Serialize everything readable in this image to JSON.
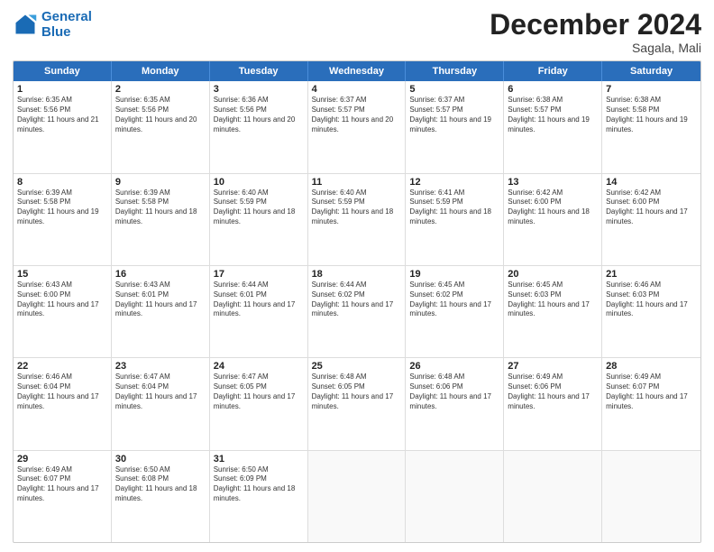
{
  "logo": {
    "line1": "General",
    "line2": "Blue"
  },
  "title": "December 2024",
  "location": "Sagala, Mali",
  "header_days": [
    "Sunday",
    "Monday",
    "Tuesday",
    "Wednesday",
    "Thursday",
    "Friday",
    "Saturday"
  ],
  "weeks": [
    [
      {
        "day": "1",
        "sunrise": "6:35 AM",
        "sunset": "5:56 PM",
        "daylight": "11 hours and 21 minutes."
      },
      {
        "day": "2",
        "sunrise": "6:35 AM",
        "sunset": "5:56 PM",
        "daylight": "11 hours and 20 minutes."
      },
      {
        "day": "3",
        "sunrise": "6:36 AM",
        "sunset": "5:56 PM",
        "daylight": "11 hours and 20 minutes."
      },
      {
        "day": "4",
        "sunrise": "6:37 AM",
        "sunset": "5:57 PM",
        "daylight": "11 hours and 20 minutes."
      },
      {
        "day": "5",
        "sunrise": "6:37 AM",
        "sunset": "5:57 PM",
        "daylight": "11 hours and 19 minutes."
      },
      {
        "day": "6",
        "sunrise": "6:38 AM",
        "sunset": "5:57 PM",
        "daylight": "11 hours and 19 minutes."
      },
      {
        "day": "7",
        "sunrise": "6:38 AM",
        "sunset": "5:58 PM",
        "daylight": "11 hours and 19 minutes."
      }
    ],
    [
      {
        "day": "8",
        "sunrise": "6:39 AM",
        "sunset": "5:58 PM",
        "daylight": "11 hours and 19 minutes."
      },
      {
        "day": "9",
        "sunrise": "6:39 AM",
        "sunset": "5:58 PM",
        "daylight": "11 hours and 18 minutes."
      },
      {
        "day": "10",
        "sunrise": "6:40 AM",
        "sunset": "5:59 PM",
        "daylight": "11 hours and 18 minutes."
      },
      {
        "day": "11",
        "sunrise": "6:40 AM",
        "sunset": "5:59 PM",
        "daylight": "11 hours and 18 minutes."
      },
      {
        "day": "12",
        "sunrise": "6:41 AM",
        "sunset": "5:59 PM",
        "daylight": "11 hours and 18 minutes."
      },
      {
        "day": "13",
        "sunrise": "6:42 AM",
        "sunset": "6:00 PM",
        "daylight": "11 hours and 18 minutes."
      },
      {
        "day": "14",
        "sunrise": "6:42 AM",
        "sunset": "6:00 PM",
        "daylight": "11 hours and 17 minutes."
      }
    ],
    [
      {
        "day": "15",
        "sunrise": "6:43 AM",
        "sunset": "6:00 PM",
        "daylight": "11 hours and 17 minutes."
      },
      {
        "day": "16",
        "sunrise": "6:43 AM",
        "sunset": "6:01 PM",
        "daylight": "11 hours and 17 minutes."
      },
      {
        "day": "17",
        "sunrise": "6:44 AM",
        "sunset": "6:01 PM",
        "daylight": "11 hours and 17 minutes."
      },
      {
        "day": "18",
        "sunrise": "6:44 AM",
        "sunset": "6:02 PM",
        "daylight": "11 hours and 17 minutes."
      },
      {
        "day": "19",
        "sunrise": "6:45 AM",
        "sunset": "6:02 PM",
        "daylight": "11 hours and 17 minutes."
      },
      {
        "day": "20",
        "sunrise": "6:45 AM",
        "sunset": "6:03 PM",
        "daylight": "11 hours and 17 minutes."
      },
      {
        "day": "21",
        "sunrise": "6:46 AM",
        "sunset": "6:03 PM",
        "daylight": "11 hours and 17 minutes."
      }
    ],
    [
      {
        "day": "22",
        "sunrise": "6:46 AM",
        "sunset": "6:04 PM",
        "daylight": "11 hours and 17 minutes."
      },
      {
        "day": "23",
        "sunrise": "6:47 AM",
        "sunset": "6:04 PM",
        "daylight": "11 hours and 17 minutes."
      },
      {
        "day": "24",
        "sunrise": "6:47 AM",
        "sunset": "6:05 PM",
        "daylight": "11 hours and 17 minutes."
      },
      {
        "day": "25",
        "sunrise": "6:48 AM",
        "sunset": "6:05 PM",
        "daylight": "11 hours and 17 minutes."
      },
      {
        "day": "26",
        "sunrise": "6:48 AM",
        "sunset": "6:06 PM",
        "daylight": "11 hours and 17 minutes."
      },
      {
        "day": "27",
        "sunrise": "6:49 AM",
        "sunset": "6:06 PM",
        "daylight": "11 hours and 17 minutes."
      },
      {
        "day": "28",
        "sunrise": "6:49 AM",
        "sunset": "6:07 PM",
        "daylight": "11 hours and 17 minutes."
      }
    ],
    [
      {
        "day": "29",
        "sunrise": "6:49 AM",
        "sunset": "6:07 PM",
        "daylight": "11 hours and 17 minutes."
      },
      {
        "day": "30",
        "sunrise": "6:50 AM",
        "sunset": "6:08 PM",
        "daylight": "11 hours and 18 minutes."
      },
      {
        "day": "31",
        "sunrise": "6:50 AM",
        "sunset": "6:09 PM",
        "daylight": "11 hours and 18 minutes."
      },
      null,
      null,
      null,
      null
    ]
  ]
}
